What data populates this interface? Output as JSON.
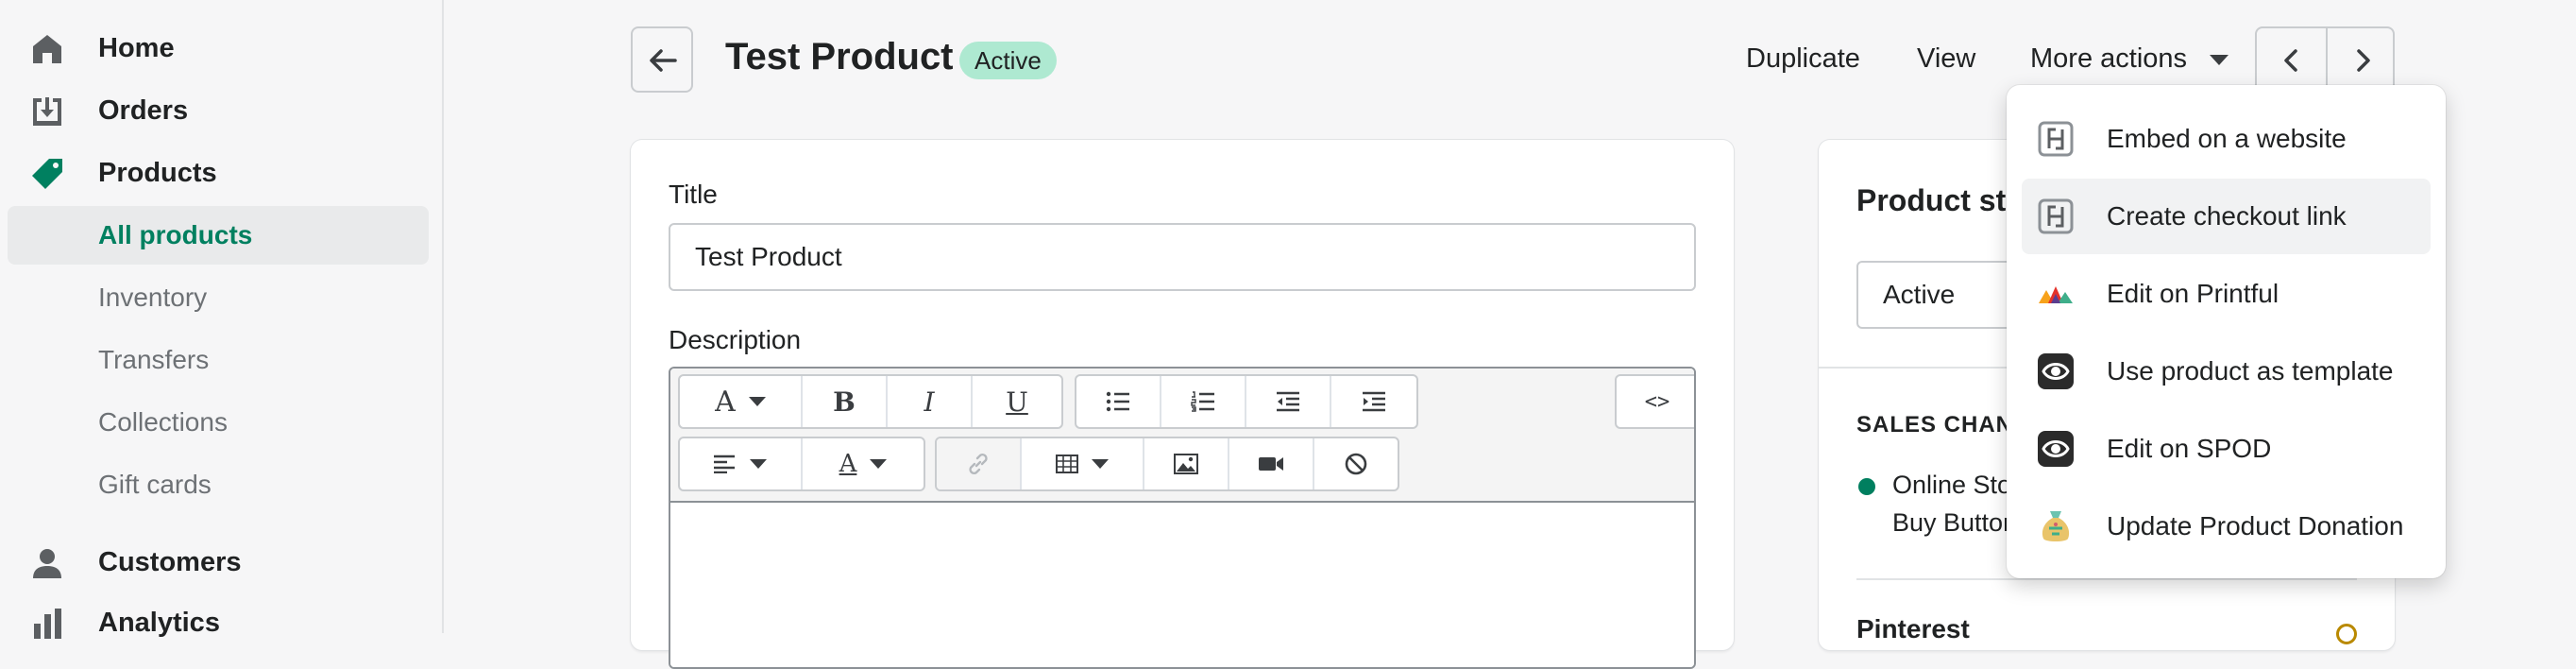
{
  "sidebar": {
    "items": [
      {
        "label": "Home",
        "icon": "home-icon"
      },
      {
        "label": "Orders",
        "icon": "orders-icon"
      },
      {
        "label": "Products",
        "icon": "tag-icon"
      },
      {
        "label": "Customers",
        "icon": "person-icon"
      },
      {
        "label": "Analytics",
        "icon": "bar-chart-icon"
      }
    ],
    "products_sub": [
      "All products",
      "Inventory",
      "Transfers",
      "Collections",
      "Gift cards"
    ]
  },
  "header": {
    "title": "Test Product",
    "status": "Active",
    "actions": {
      "duplicate": "Duplicate",
      "view": "View",
      "more": "More actions"
    }
  },
  "main": {
    "title_label": "Title",
    "title_value": "Test Product",
    "description_label": "Description",
    "editor_toolbar": {
      "font_glyph": "A",
      "bold_glyph": "B",
      "italic_glyph": "I",
      "underline_glyph": "U",
      "source_glyph": "<>",
      "color_glyph": "A"
    }
  },
  "status_card": {
    "title": "Product st",
    "status_value": "Active",
    "sales_channels_heading": "SALES CHANN",
    "channels_line1": "Online Stor",
    "channels_line2": "Buy Button",
    "next_section": "Pinterest"
  },
  "more_actions_menu": {
    "items": [
      {
        "label": "Embed on a website",
        "icon": "buy-button-icon"
      },
      {
        "label": "Create checkout link",
        "icon": "buy-button-icon"
      },
      {
        "label": "Edit on Printful",
        "icon": "printful-icon"
      },
      {
        "label": "Use product as template",
        "icon": "spod-icon"
      },
      {
        "label": "Edit on SPOD",
        "icon": "spod-icon"
      },
      {
        "label": "Update Product Donation",
        "icon": "donation-bag-icon"
      }
    ]
  },
  "colors": {
    "accent_green": "#008060",
    "active_badge": "#aee9d1",
    "background": "#f6f6f7"
  }
}
